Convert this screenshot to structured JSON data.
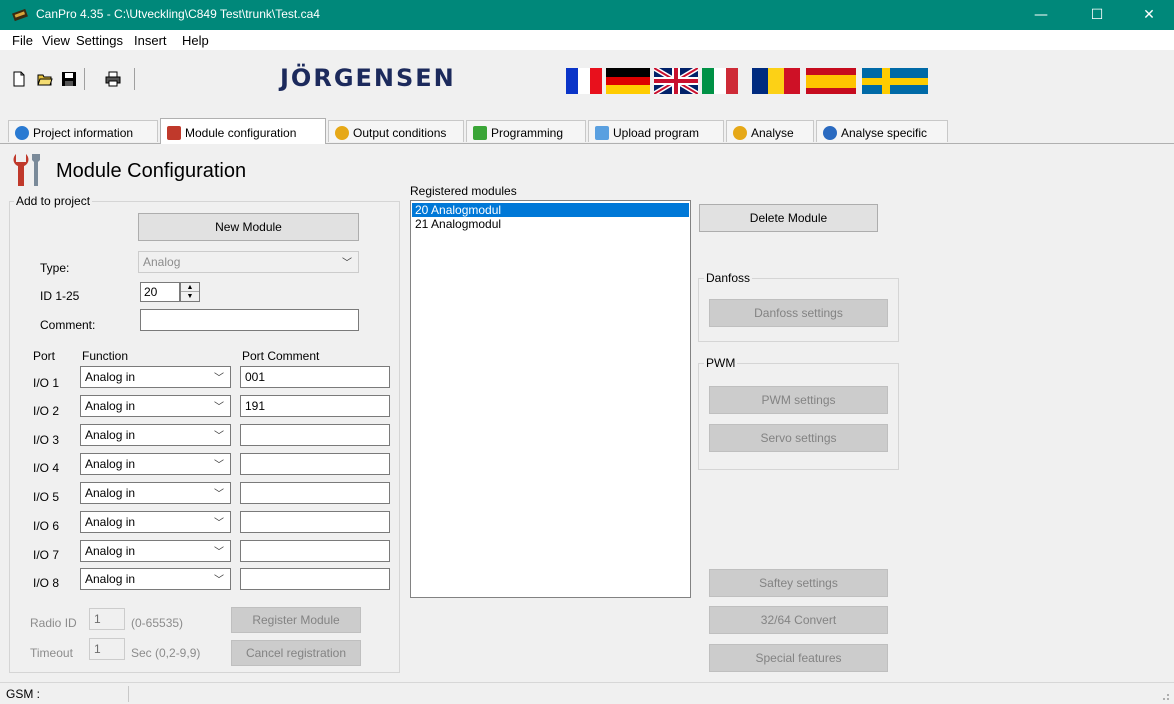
{
  "window": {
    "title": "CanPro 4.35 - C:\\Utveckling\\C849 Test\\trunk\\Test.ca4",
    "minimize": "—",
    "maximize": "☐",
    "close": "✕"
  },
  "menu": [
    "File",
    "View",
    "Settings",
    "Insert",
    "Help"
  ],
  "toolbar": {
    "icons": [
      "new-file-icon",
      "open-folder-icon",
      "save-icon",
      "print-icon"
    ],
    "logo": "JÖRGENSEN",
    "flags": [
      "france",
      "germany",
      "united-kingdom",
      "italy",
      "romania",
      "spain",
      "sweden"
    ]
  },
  "tabs": [
    {
      "label": "Project information",
      "icon": "info-icon",
      "color": "#2a7ad2"
    },
    {
      "label": "Module configuration",
      "icon": "tools-icon",
      "color": "#c0392b"
    },
    {
      "label": "Output conditions",
      "icon": "gear-icon",
      "color": "#e6a817"
    },
    {
      "label": "Programming",
      "icon": "down-arrow-icon",
      "color": "#3aa537"
    },
    {
      "label": "Upload program",
      "icon": "up-arrow-icon",
      "color": "#5aa0e0"
    },
    {
      "label": "Analyse",
      "icon": "speech-icon",
      "color": "#e6a817"
    },
    {
      "label": "Analyse specific",
      "icon": "magnifier-icon",
      "color": "#2a6ac0"
    }
  ],
  "page": {
    "heading": "Module Configuration"
  },
  "add_group": {
    "label": "Add to project",
    "new_module": "New Module",
    "type_label": "Type:",
    "type_value": "Analog",
    "id_label": "ID 1-25",
    "id_value": "20",
    "comment_label": "Comment:",
    "comment_value": "",
    "port_header": "Port",
    "function_header": "Function",
    "port_comment_header": "Port Comment",
    "ports": [
      {
        "port": "I/O 1",
        "function": "Analog in",
        "comment": "001"
      },
      {
        "port": "I/O 2",
        "function": "Analog in",
        "comment": "191"
      },
      {
        "port": "I/O 3",
        "function": "Analog in",
        "comment": ""
      },
      {
        "port": "I/O 4",
        "function": "Analog in",
        "comment": ""
      },
      {
        "port": "I/O 5",
        "function": "Analog in",
        "comment": ""
      },
      {
        "port": "I/O 6",
        "function": "Analog in",
        "comment": ""
      },
      {
        "port": "I/O 7",
        "function": "Analog in",
        "comment": ""
      },
      {
        "port": "I/O 8",
        "function": "Analog in",
        "comment": ""
      }
    ],
    "radio_id_label": "Radio ID",
    "radio_id_value": "1",
    "radio_range": "(0-65535)",
    "register_module": "Register Module",
    "timeout_label": "Timeout",
    "timeout_value": "1",
    "timeout_range": "Sec (0,2-9,9)",
    "cancel_registration": "Cancel registration"
  },
  "registered": {
    "label": "Registered modules",
    "items": [
      {
        "text": "20  Analogmodul",
        "selected": true
      },
      {
        "text": "21  Analogmodul",
        "selected": false
      }
    ]
  },
  "right": {
    "delete_module": "Delete Module",
    "danfoss_group": "Danfoss",
    "danfoss_settings": "Danfoss settings",
    "pwm_group": "PWM",
    "pwm_settings": "PWM settings",
    "servo_settings": "Servo settings",
    "saftey_settings": "Saftey settings",
    "convert": "32/64 Convert",
    "special_features": "Special features"
  },
  "status": {
    "gsm": "GSM :"
  }
}
